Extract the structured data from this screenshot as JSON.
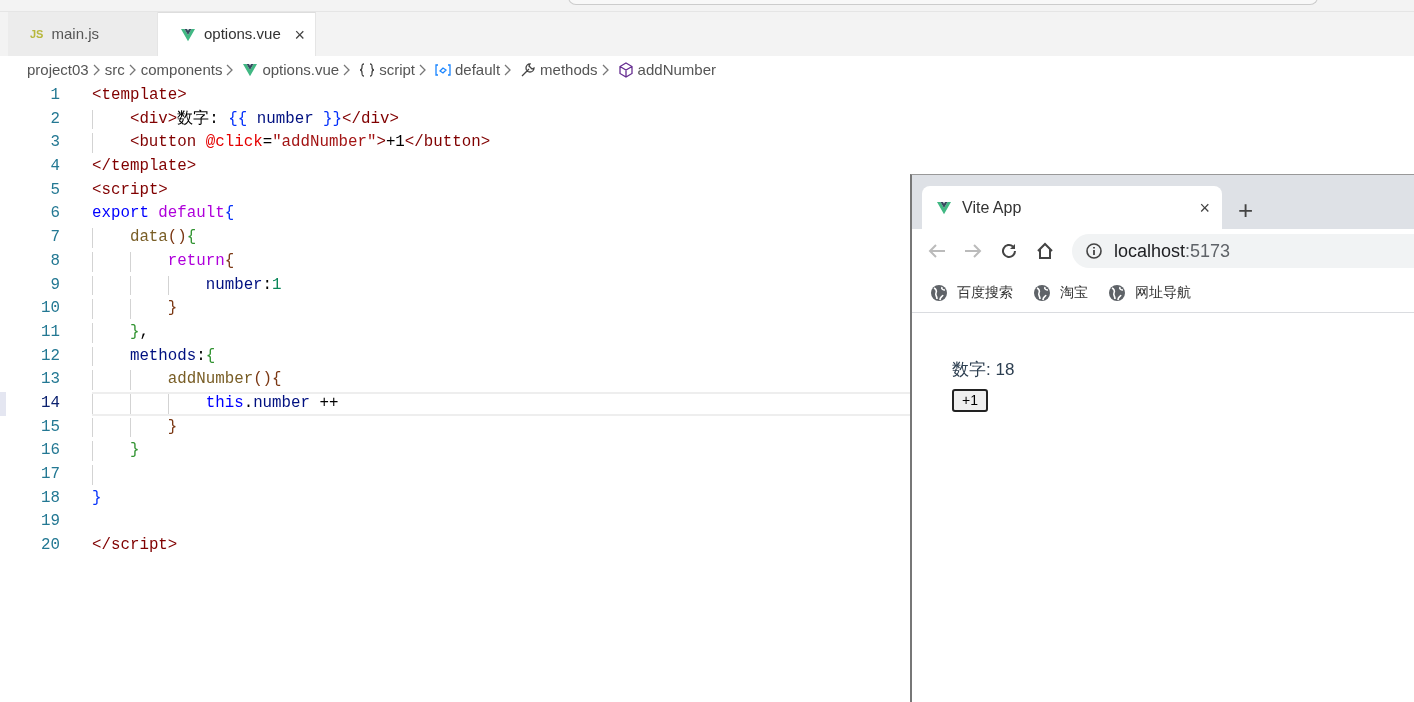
{
  "editor": {
    "tabs": [
      {
        "label": "main.js",
        "badge": "JS",
        "kind": "js",
        "selected": false
      },
      {
        "label": "options.vue",
        "close": "×",
        "kind": "vue",
        "selected": true
      }
    ],
    "breadcrumb": [
      {
        "label": "project03",
        "kind": "folder"
      },
      {
        "label": "src",
        "kind": "folder"
      },
      {
        "label": "components",
        "kind": "folder"
      },
      {
        "label": "options.vue",
        "kind": "vue"
      },
      {
        "label": "script",
        "kind": "braces"
      },
      {
        "label": "default",
        "kind": "module"
      },
      {
        "label": "methods",
        "kind": "wrench"
      },
      {
        "label": "addNumber",
        "kind": "cube"
      }
    ],
    "lines": [
      {
        "number": "1",
        "current": false,
        "tokens": [
          {
            "text": "<template>",
            "kind": "tag"
          }
        ],
        "children": [
          {
            "number": "2",
            "current": false,
            "tokens": [
              {
                "text": "<div>",
                "kind": "tag"
              },
              {
                "text": "数字: ",
                "kind": "text"
              },
              {
                "text": "{{",
                "kind": "b1"
              },
              {
                "text": " number ",
                "kind": "var"
              },
              {
                "text": "}}",
                "kind": "b1"
              },
              {
                "text": "</div>",
                "kind": "tag"
              }
            ]
          },
          {
            "number": "3",
            "current": false,
            "tokens": [
              {
                "text": "<button ",
                "kind": "tag"
              },
              {
                "text": "@click",
                "kind": "attr"
              },
              {
                "text": "=",
                "kind": "text"
              },
              {
                "text": "\"addNumber\"",
                "kind": "string"
              },
              {
                "text": ">",
                "kind": "tag"
              },
              {
                "text": "+1",
                "kind": "text"
              },
              {
                "text": "</button>",
                "kind": "tag"
              }
            ]
          }
        ]
      },
      {
        "number": "4",
        "current": false,
        "tokens": [
          {
            "text": "</template>",
            "kind": "tag"
          }
        ]
      },
      {
        "number": "5",
        "current": false,
        "tokens": [
          {
            "text": "<script>",
            "kind": "tag"
          }
        ]
      },
      {
        "number": "6",
        "current": false,
        "tokens": [
          {
            "text": "export ",
            "kind": "keyword"
          },
          {
            "text": "default",
            "kind": "control"
          },
          {
            "text": "{",
            "kind": "b1"
          }
        ],
        "children": [
          {
            "number": "7",
            "current": false,
            "tokens": [
              {
                "text": "data",
                "kind": "fn"
              },
              {
                "text": "()",
                "kind": "b3"
              },
              {
                "text": "{",
                "kind": "b2"
              }
            ],
            "children": [
              {
                "number": "8",
                "current": false,
                "tokens": [
                  {
                    "text": "return",
                    "kind": "control"
                  },
                  {
                    "text": "{",
                    "kind": "b3"
                  }
                ],
                "children": [
                  {
                    "number": "9",
                    "current": false,
                    "tokens": [
                      {
                        "text": "number",
                        "kind": "var"
                      },
                      {
                        "text": ":",
                        "kind": "text"
                      },
                      {
                        "text": "1",
                        "kind": "num"
                      }
                    ]
                  }
                ]
              },
              {
                "number": "10",
                "current": false,
                "tokens": [
                  {
                    "text": "}",
                    "kind": "b3"
                  }
                ]
              }
            ]
          },
          {
            "number": "11",
            "current": false,
            "tokens": [
              {
                "text": "}",
                "kind": "b2"
              },
              {
                "text": ",",
                "kind": "text"
              }
            ]
          },
          {
            "number": "12",
            "current": false,
            "tokens": [
              {
                "text": "methods",
                "kind": "var"
              },
              {
                "text": ":",
                "kind": "text"
              },
              {
                "text": "{",
                "kind": "b2"
              }
            ],
            "children": [
              {
                "number": "13",
                "current": false,
                "tokens": [
                  {
                    "text": "addNumber",
                    "kind": "fn"
                  },
                  {
                    "text": "(){",
                    "kind": "b3"
                  }
                ],
                "children": [
                  {
                    "number": "14",
                    "current": true,
                    "tokens": [
                      {
                        "text": "this",
                        "kind": "keyword"
                      },
                      {
                        "text": ".",
                        "kind": "text"
                      },
                      {
                        "text": "number",
                        "kind": "var"
                      },
                      {
                        "text": " ++",
                        "kind": "text"
                      }
                    ]
                  }
                ]
              },
              {
                "number": "15",
                "current": false,
                "tokens": [
                  {
                    "text": "}",
                    "kind": "b3"
                  }
                ]
              }
            ]
          },
          {
            "number": "16",
            "current": false,
            "tokens": [
              {
                "text": "}",
                "kind": "b2"
              }
            ]
          },
          {
            "number": "17",
            "current": false
          }
        ]
      },
      {
        "number": "18",
        "current": false,
        "tokens": [
          {
            "text": "}",
            "kind": "b1"
          }
        ]
      },
      {
        "number": "19",
        "current": false
      },
      {
        "number": "20",
        "current": false,
        "tokens": [
          {
            "text": "</script>",
            "kind": "tag"
          }
        ]
      }
    ]
  },
  "browser": {
    "tab_title": "Vite App",
    "tab_close": "×",
    "new_tab": "+",
    "address_host": "localhost",
    "address_port": ":5173",
    "bookmarks": [
      {
        "label": "百度搜索"
      },
      {
        "label": "淘宝"
      },
      {
        "label": "网址导航"
      }
    ],
    "page": {
      "text": "数字: 18",
      "button": "+1"
    }
  }
}
